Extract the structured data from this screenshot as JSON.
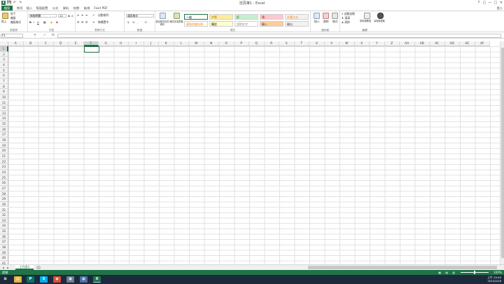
{
  "window": {
    "title": "活頁簿1 - Excel",
    "app_logo": "X",
    "help": "?",
    "ribbon_display": "□",
    "minimize": "—",
    "maximize": "□",
    "close": "✕"
  },
  "quick_access": {
    "save": "💾",
    "undo": "↶",
    "redo": "↷"
  },
  "tabs": [
    "檔案",
    "常用",
    "插入",
    "版面配置",
    "公式",
    "資料",
    "校閱",
    "檢視",
    "Foxit PDF"
  ],
  "active_tab": "常用",
  "signin": "登入",
  "ribbon": {
    "clipboard": {
      "label": "剪貼簿",
      "paste": "貼上",
      "cut": "剪下",
      "copy": "複製",
      "painter": "複製格式"
    },
    "font": {
      "label": "字型",
      "font_name": "新細明體",
      "font_size": "12"
    },
    "alignment": {
      "label": "對齊方式",
      "wrap": "自動換列",
      "merge": "跨欄置中"
    },
    "number": {
      "label": "數值",
      "format": "通用格式",
      "currency": "$",
      "percent": "%",
      "comma": ","
    },
    "styles": {
      "label": "樣式",
      "conditional": "設定格式化的條件",
      "table": "格式化為表格",
      "cells": [
        {
          "name": "一般",
          "bg": "#ffffff",
          "fg": "#000000"
        },
        {
          "name": "中等",
          "bg": "#ffeb9c",
          "fg": "#9c6500"
        },
        {
          "name": "好",
          "bg": "#c6efce",
          "fg": "#006100"
        },
        {
          "name": "壞",
          "bg": "#ffc7ce",
          "fg": "#9c0006"
        },
        {
          "name": "計算方式",
          "bg": "#f2f2f2",
          "fg": "#fa7d00"
        },
        {
          "name": "連結的儲存格",
          "bg": "#ffffff",
          "fg": "#fa7d00"
        },
        {
          "name": "備註",
          "bg": "#ffffcc",
          "fg": "#000000"
        },
        {
          "name": "說明文字",
          "bg": "#ffffff",
          "fg": "#7f7f7f"
        },
        {
          "name": "輸入",
          "bg": "#ffcc99",
          "fg": "#3f3f76"
        },
        {
          "name": "輸出",
          "bg": "#f2f2f2",
          "fg": "#3f3f3f"
        }
      ]
    },
    "cells": {
      "label": "儲存格",
      "insert": "插入",
      "delete": "刪除",
      "format": "格式"
    },
    "editing": {
      "label": "編輯",
      "autosum": "自動加總",
      "fill": "填滿",
      "clear": "清除",
      "sort": "排序與篩選",
      "find": "尋找與選取"
    }
  },
  "formula_bar": {
    "name_box": "F1",
    "cancel": "✕",
    "enter": "✓",
    "fx": "fx",
    "value": ""
  },
  "columns": [
    "A",
    "B",
    "C",
    "D",
    "E",
    "F",
    "G",
    "H",
    "I",
    "J",
    "K",
    "L",
    "M",
    "N",
    "O",
    "P",
    "Q",
    "R",
    "S",
    "T",
    "U",
    "V",
    "W",
    "X",
    "Y",
    "Z",
    "AA",
    "AB",
    "AC",
    "AD",
    "AE",
    "AF"
  ],
  "rows": [
    "1",
    "2",
    "3",
    "4",
    "5",
    "6",
    "7",
    "8",
    "9",
    "10",
    "11",
    "12",
    "13",
    "14",
    "15",
    "16",
    "17",
    "18",
    "19",
    "20",
    "21",
    "22",
    "23",
    "24",
    "25",
    "26",
    "27",
    "28",
    "29",
    "30",
    "31",
    "32",
    "33",
    "34",
    "35",
    "36",
    "37",
    "38",
    "39",
    "40",
    "41"
  ],
  "active_cell": {
    "column": "F",
    "row": "1"
  },
  "sheets": [
    "工作表1"
  ],
  "add_sheet": "+",
  "status": {
    "ready": "就緒",
    "zoom": "100%"
  },
  "taskbar": {
    "clock_time": "上午 10:40",
    "clock_date": "2015/2/16",
    "apps": [
      {
        "name": "start",
        "glyph": "⊞",
        "color": "#1c2a3c"
      },
      {
        "name": "explorer",
        "glyph": "▤",
        "color": "#e8b23a"
      },
      {
        "name": "publisher",
        "glyph": "P",
        "color": "#077568"
      },
      {
        "name": "skype",
        "glyph": "S",
        "color": "#00aff0"
      },
      {
        "name": "chrome",
        "glyph": "◉",
        "color": "#dd4b39"
      },
      {
        "name": "app5",
        "glyph": "▣",
        "color": "#6b7c93"
      },
      {
        "name": "app6",
        "glyph": "▦",
        "color": "#4a6fa5"
      },
      {
        "name": "excel",
        "glyph": "X",
        "color": "#217346"
      }
    ]
  }
}
